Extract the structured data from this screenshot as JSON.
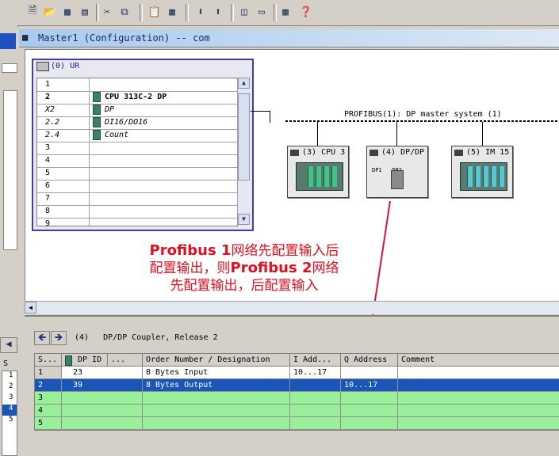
{
  "toolbar": {
    "icons": [
      "new-icon",
      "open-icon",
      "save-icon",
      "print-icon",
      "cut-icon",
      "copy-icon",
      "paste-icon",
      "download-icon",
      "upload-icon",
      "catalog-icon",
      "split-view-icon",
      "full-view-icon",
      "help-icon"
    ]
  },
  "window": {
    "title": "Master1 (Configuration) -- com"
  },
  "rack": {
    "title": "(0) UR",
    "rows": [
      {
        "slot": "1",
        "module": ""
      },
      {
        "slot": "2",
        "module": "CPU 313C-2 DP"
      },
      {
        "slot": "X2",
        "module": "DP"
      },
      {
        "slot": "2.2",
        "module": "DI16/DO16"
      },
      {
        "slot": "2.4",
        "module": "Count"
      },
      {
        "slot": "3",
        "module": ""
      },
      {
        "slot": "4",
        "module": ""
      },
      {
        "slot": "5",
        "module": ""
      },
      {
        "slot": "6",
        "module": ""
      },
      {
        "slot": "7",
        "module": ""
      },
      {
        "slot": "8",
        "module": ""
      },
      {
        "slot": "9",
        "module": ""
      }
    ]
  },
  "bus": {
    "label": "PROFIBUS(1): DP master system (1)"
  },
  "slaves": [
    {
      "label": "(3) CPU 3",
      "inner": ""
    },
    {
      "label": "(4) DP/DP",
      "inner": "DP1   DP2"
    },
    {
      "label": "(5) IM 15",
      "inner": ""
    }
  ],
  "annotation": {
    "line1_bold": "Profibus 1",
    "line1_rest": "网络先配置输入后",
    "line2_a": "配置输出，则",
    "line2_bold": "Profibus 2",
    "line2_b": "网络",
    "line3": "先配置输出，后配置输入",
    "color": "#e01020"
  },
  "detail": {
    "title": "(4)   DP/DP Coupler, Release 2",
    "columns": [
      "S...",
      "DP ID",
      "...",
      "Order Number / Designation",
      "I Add...",
      "Q Address",
      "Comment"
    ],
    "rows": [
      {
        "s": "1",
        "dpid": "23",
        "order": "8 Bytes Input",
        "i": "10...17",
        "q": "",
        "comment": "",
        "style": "white"
      },
      {
        "s": "2",
        "dpid": "39",
        "order": "8 Bytes Output",
        "i": "",
        "q": "10...17",
        "comment": "",
        "style": "sel"
      },
      {
        "s": "3",
        "dpid": "",
        "order": "",
        "i": "",
        "q": "",
        "comment": "",
        "style": "green"
      },
      {
        "s": "4",
        "dpid": "",
        "order": "",
        "i": "",
        "q": "",
        "comment": "",
        "style": "green"
      },
      {
        "s": "5",
        "dpid": "",
        "order": "",
        "i": "",
        "q": "",
        "comment": "",
        "style": "green"
      }
    ]
  },
  "leftstrip": {
    "label_s": "S",
    "rows": [
      "1",
      "2",
      "3",
      "4",
      "5"
    ]
  }
}
